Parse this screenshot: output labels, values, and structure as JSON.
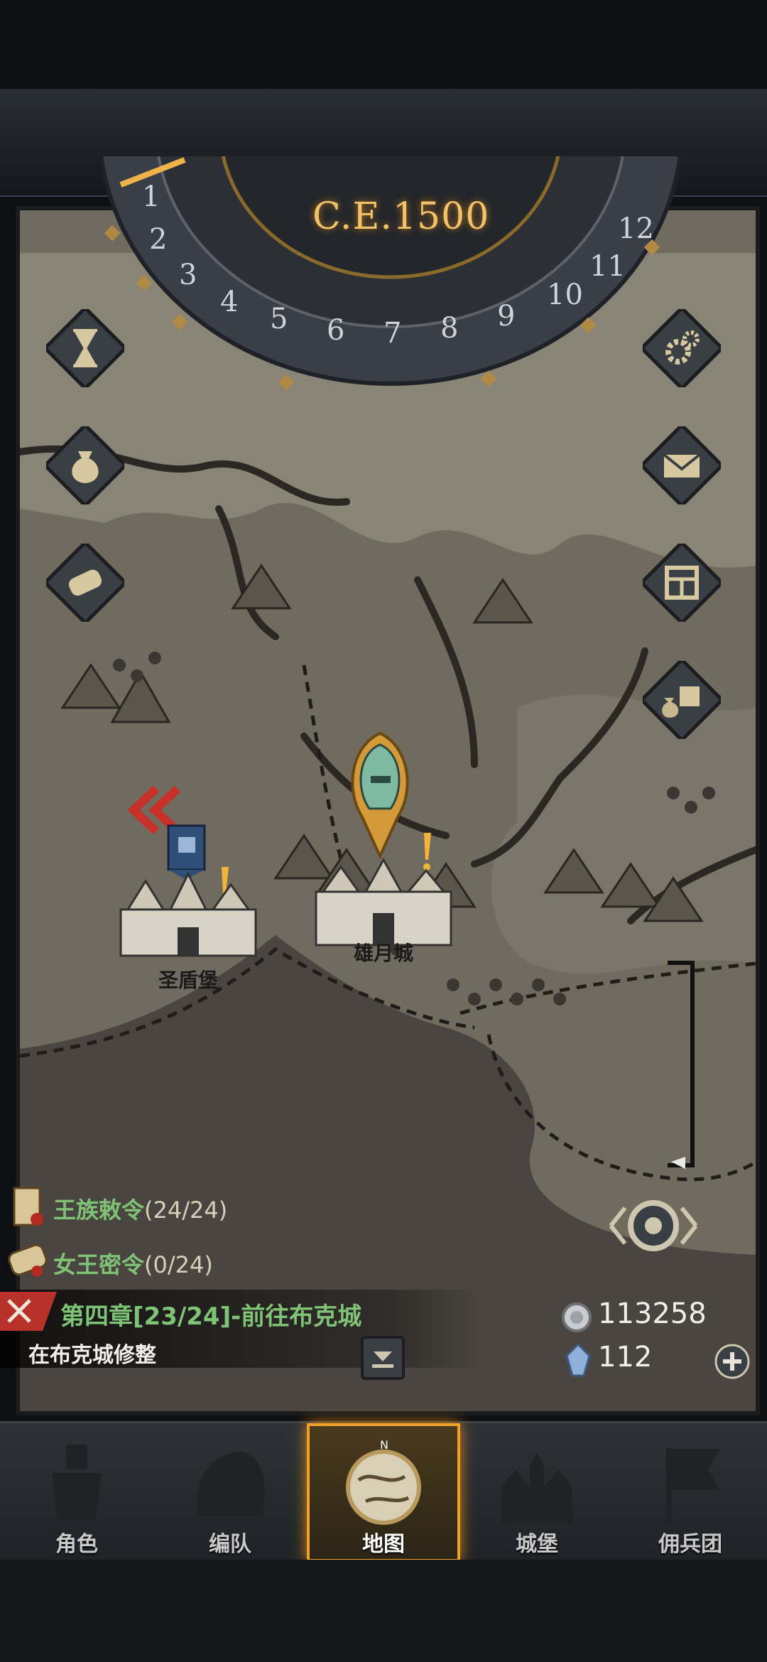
{
  "calendar": {
    "year": "C.E.1500",
    "months": [
      "1",
      "2",
      "3",
      "4",
      "5",
      "6",
      "7",
      "8",
      "9",
      "10",
      "11",
      "12"
    ]
  },
  "side_buttons_left": [
    {
      "name": "hourglass-icon"
    },
    {
      "name": "money-bag-icon"
    },
    {
      "name": "scroll-icon"
    }
  ],
  "side_buttons_right": [
    {
      "name": "gear-icon"
    },
    {
      "name": "envelope-icon"
    },
    {
      "name": "window-icon"
    },
    {
      "name": "supplies-icon"
    }
  ],
  "cities": {
    "left": "圣盾堡",
    "center": "雄月城"
  },
  "orders": {
    "royal_name": "王族敕令",
    "royal_count": "(24/24)",
    "queen_name": "女王密令",
    "queen_count": "(0/24)"
  },
  "quest": {
    "title": "第四章[23/24]-前往布克城",
    "subtitle": "在布克城修整"
  },
  "resources": {
    "silver": "113258",
    "crystal": "112"
  },
  "nav": {
    "items": [
      {
        "label": "角色",
        "icon": "knight-icon"
      },
      {
        "label": "编队",
        "icon": "helmet-icon"
      },
      {
        "label": "地图",
        "icon": "compass-map-icon"
      },
      {
        "label": "城堡",
        "icon": "castle-icon"
      },
      {
        "label": "佣兵团",
        "icon": "banner-icon"
      }
    ],
    "active_index": 2
  },
  "colors": {
    "accent": "#f0a12a",
    "green_text": "#7fc476",
    "map_base": "#6c665b"
  }
}
